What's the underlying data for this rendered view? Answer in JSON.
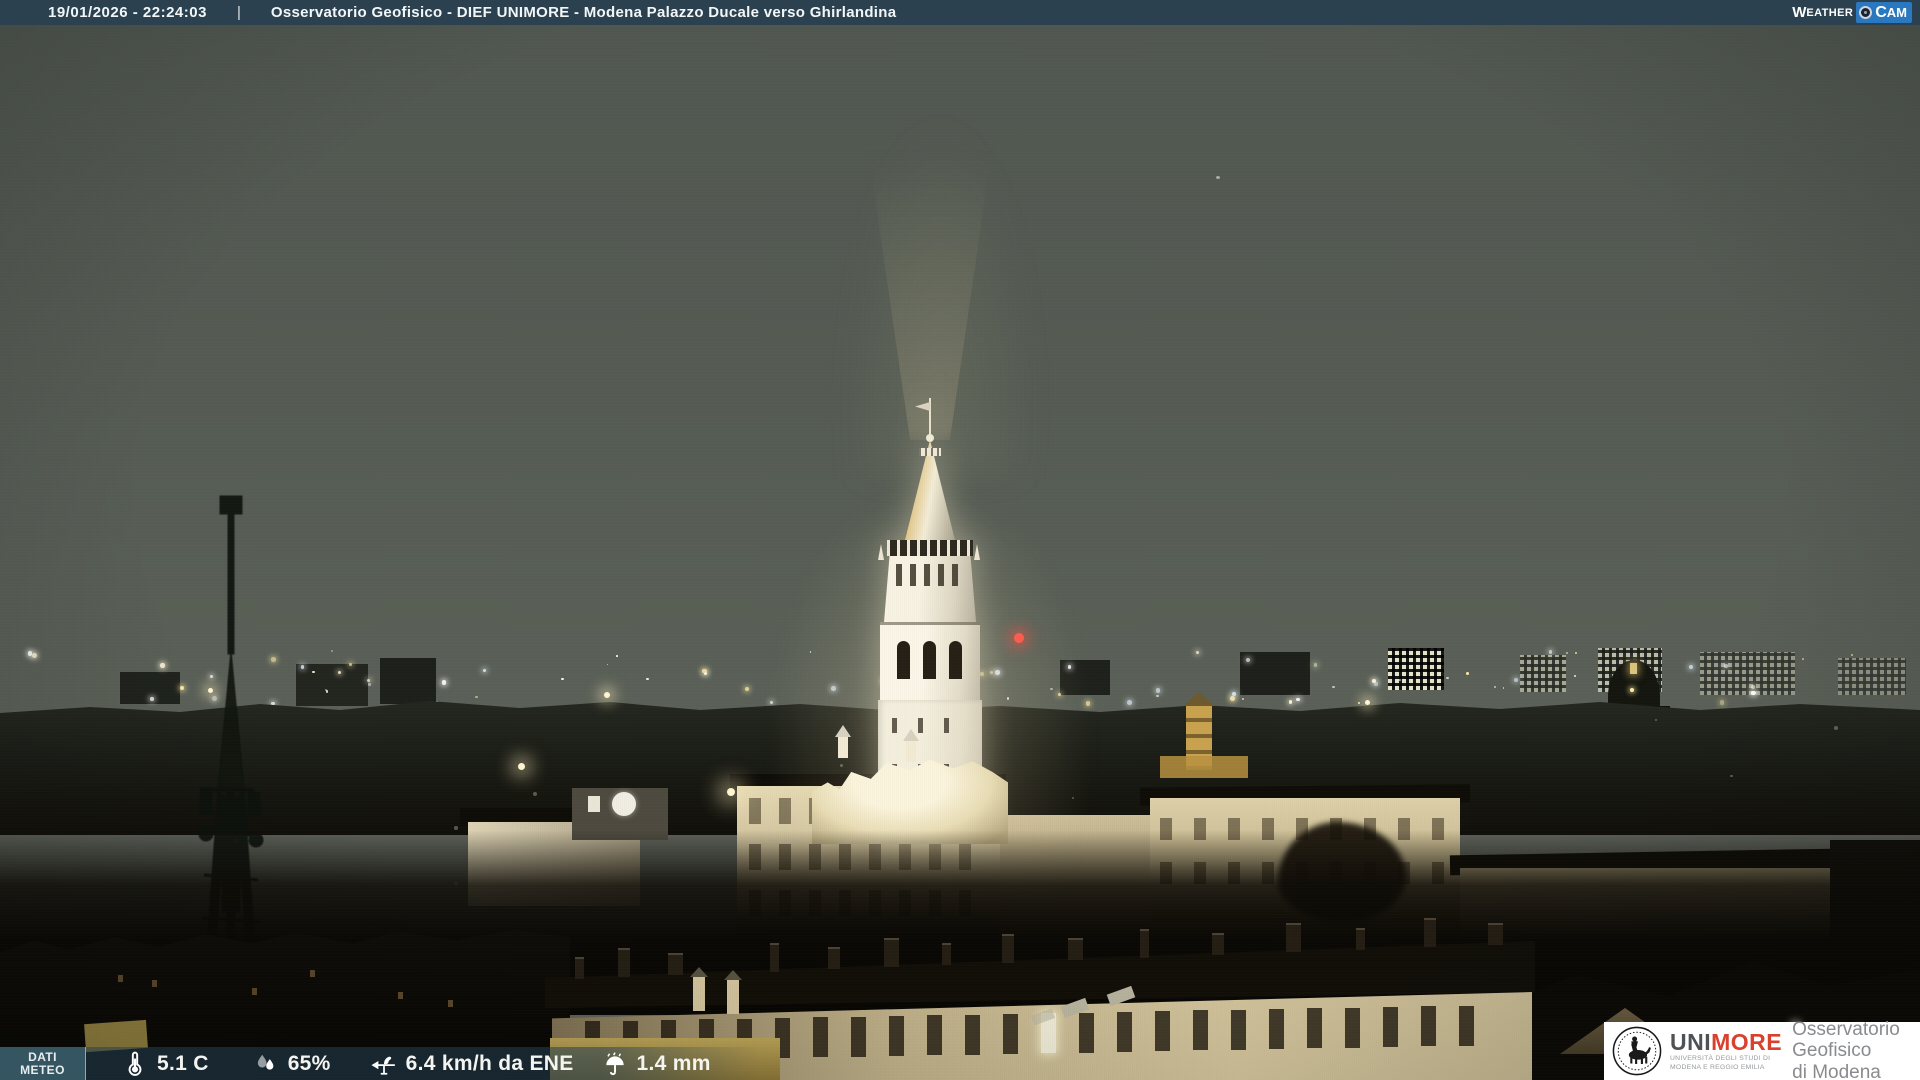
{
  "header": {
    "datetime": "19/01/2026 - 22:24:03",
    "separator": "|",
    "title": "Osservatorio Geofisico - DIEF UNIMORE - Modena Palazzo Ducale verso Ghirlandina",
    "logo": {
      "weather_w": "W",
      "weather_rest": "EATHER",
      "cam_c": "C",
      "cam_rest": "AM"
    }
  },
  "meteo_bar": {
    "label_line1": "DATI",
    "label_line2": "METEO",
    "readings": [
      {
        "icon": "thermometer-icon",
        "value": "5.1 C"
      },
      {
        "icon": "humidity-icon",
        "value": "65%"
      },
      {
        "icon": "wind-vane-icon",
        "value": "6.4 km/h da ENE"
      },
      {
        "icon": "rain-icon",
        "value": "1.4 mm"
      }
    ]
  },
  "footer_logo": {
    "unimore_uni": "UNI",
    "unimore_more": "MORE",
    "subtitle_line1": "UNIVERSITÀ DEGLI STUDI DI",
    "subtitle_line2": "MODENA E REGGIO EMILIA",
    "right_line1": "Osservatorio Geofisico",
    "right_line2": "di Modena"
  },
  "colors": {
    "topbar_bg": "#2b4150",
    "logo_blue": "#2a79c0",
    "unimore_red": "#d9412e",
    "unimore_gray": "#4f5254",
    "footer_text": "#898b8e",
    "beacon_red": "#ff5247",
    "tower_warm": "#d9b566"
  }
}
